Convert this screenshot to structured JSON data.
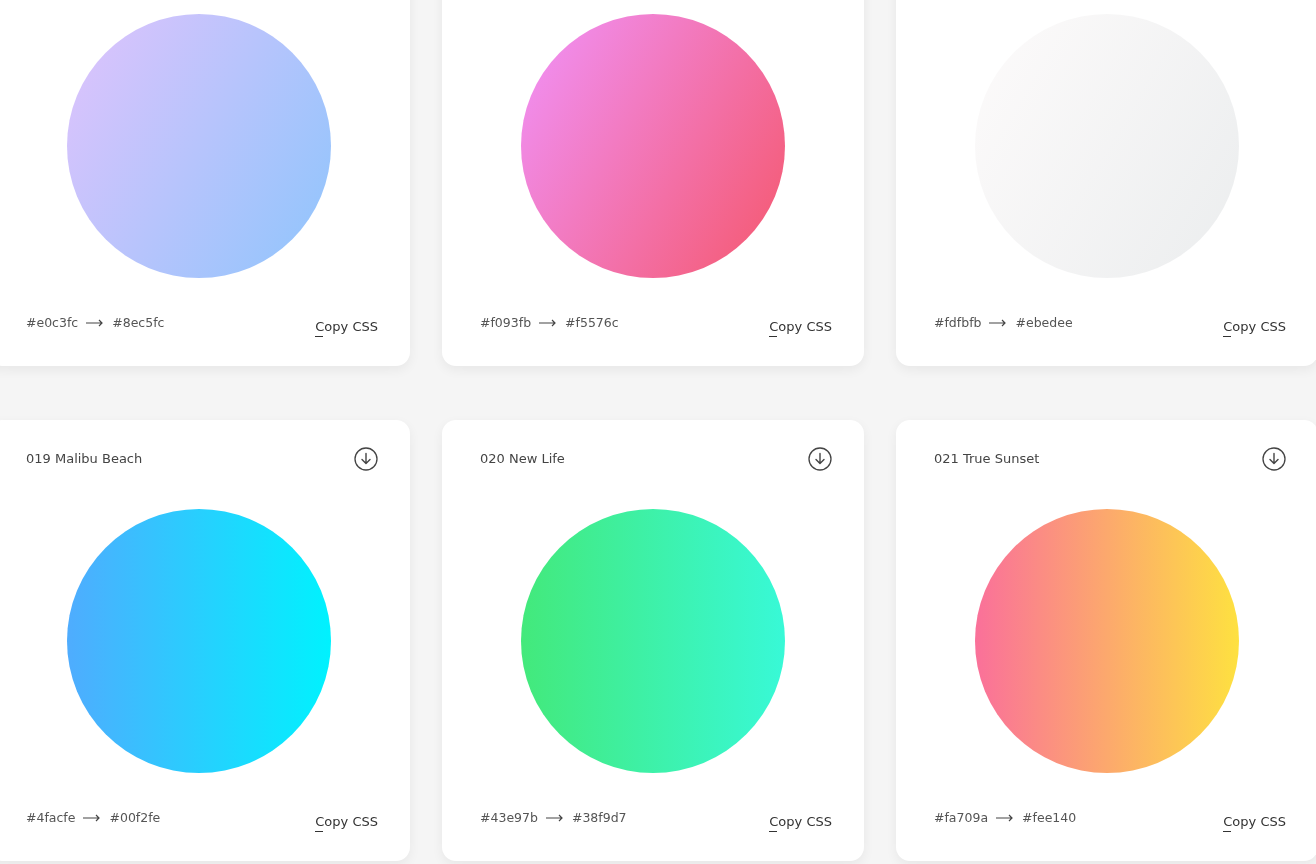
{
  "cards": [
    {
      "from": "#e0c3fc",
      "to": "#8ec5fc",
      "kind": "diagonal",
      "action": "Copy CSS"
    },
    {
      "from": "#f093fb",
      "to": "#f5576c",
      "kind": "diagonal",
      "action": "Copy CSS"
    },
    {
      "from": "#fdfbfb",
      "to": "#ebedee",
      "kind": "diagonal",
      "action": "Copy CSS"
    },
    {
      "title": "019 Malibu Beach",
      "from": "#4facfe",
      "to": "#00f2fe",
      "kind": "horizontal",
      "action": "Copy CSS"
    },
    {
      "title": "020 New Life",
      "from": "#43e97b",
      "to": "#38f9d7",
      "kind": "horizontal",
      "action": "Copy CSS"
    },
    {
      "title": "021 True Sunset",
      "from": "#fa709a",
      "to": "#fee140",
      "kind": "horizontal",
      "action": "Copy CSS"
    }
  ]
}
